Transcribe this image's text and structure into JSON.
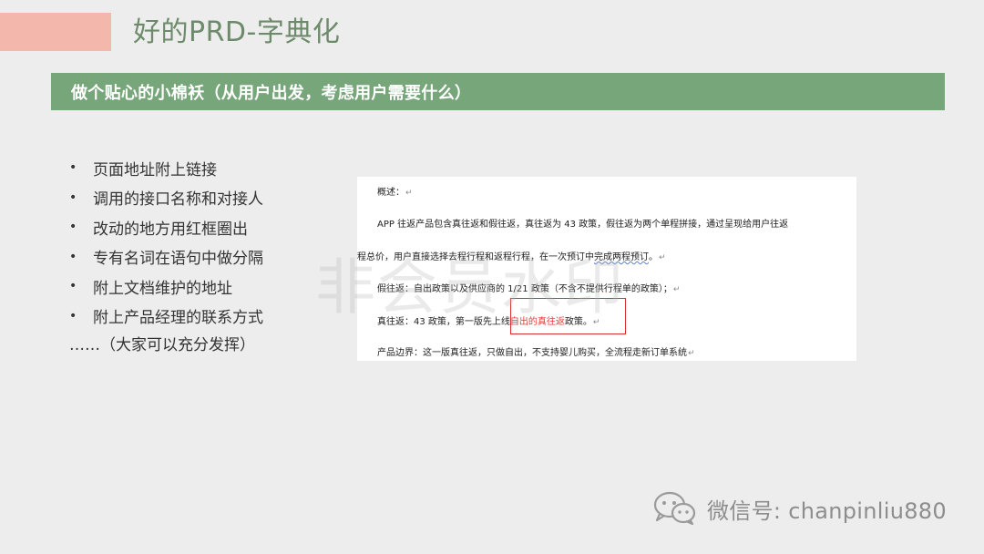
{
  "title": "好的PRD-字典化",
  "banner": "做个贴心的小棉袄（从用户出发，考虑用户需要什么）",
  "bullets": [
    "页面地址附上链接",
    "调用的接口名称和对接人",
    "改动的地方用红框圈出",
    "专有名词在语句中做分隔",
    "附上文档维护的地址",
    "附上产品经理的联系方式"
  ],
  "trailing": "……（大家可以充分发挥）",
  "watermark": "非会员水印",
  "doc": {
    "line1": "概述：",
    "line2": "APP 往返产品包含真往返和假往返，真往返为 43 政策，假往返为两个单程拼接，通过呈现给用户往返",
    "line3_a": "程总价，用户直接选择去程行程和返程行程，在一次预订中",
    "line3_b": "完成两程预订",
    "line3_c": "。",
    "line4": "假往返：自出政策以及供应商的 1/21 政策（不含不提供行程单的政策）；",
    "line5_a": "真往返：43 政策，第一版先上线",
    "line5_red": "自出的真往返",
    "line5_c": "政策。",
    "line6": "产品边界：这一版真往返，只做自出，不支持婴儿购买，全流程走新订单系统",
    "return_mark": "↵"
  },
  "footer": {
    "icon": "wechat-icon",
    "text": "微信号: chanpinliu880"
  },
  "colors": {
    "title": "#6d8a6a",
    "banner_bg": "#78a67b",
    "accent": "#f4b7ac",
    "highlight_box": "#d9302f",
    "highlight_text": "#e23b3b"
  }
}
